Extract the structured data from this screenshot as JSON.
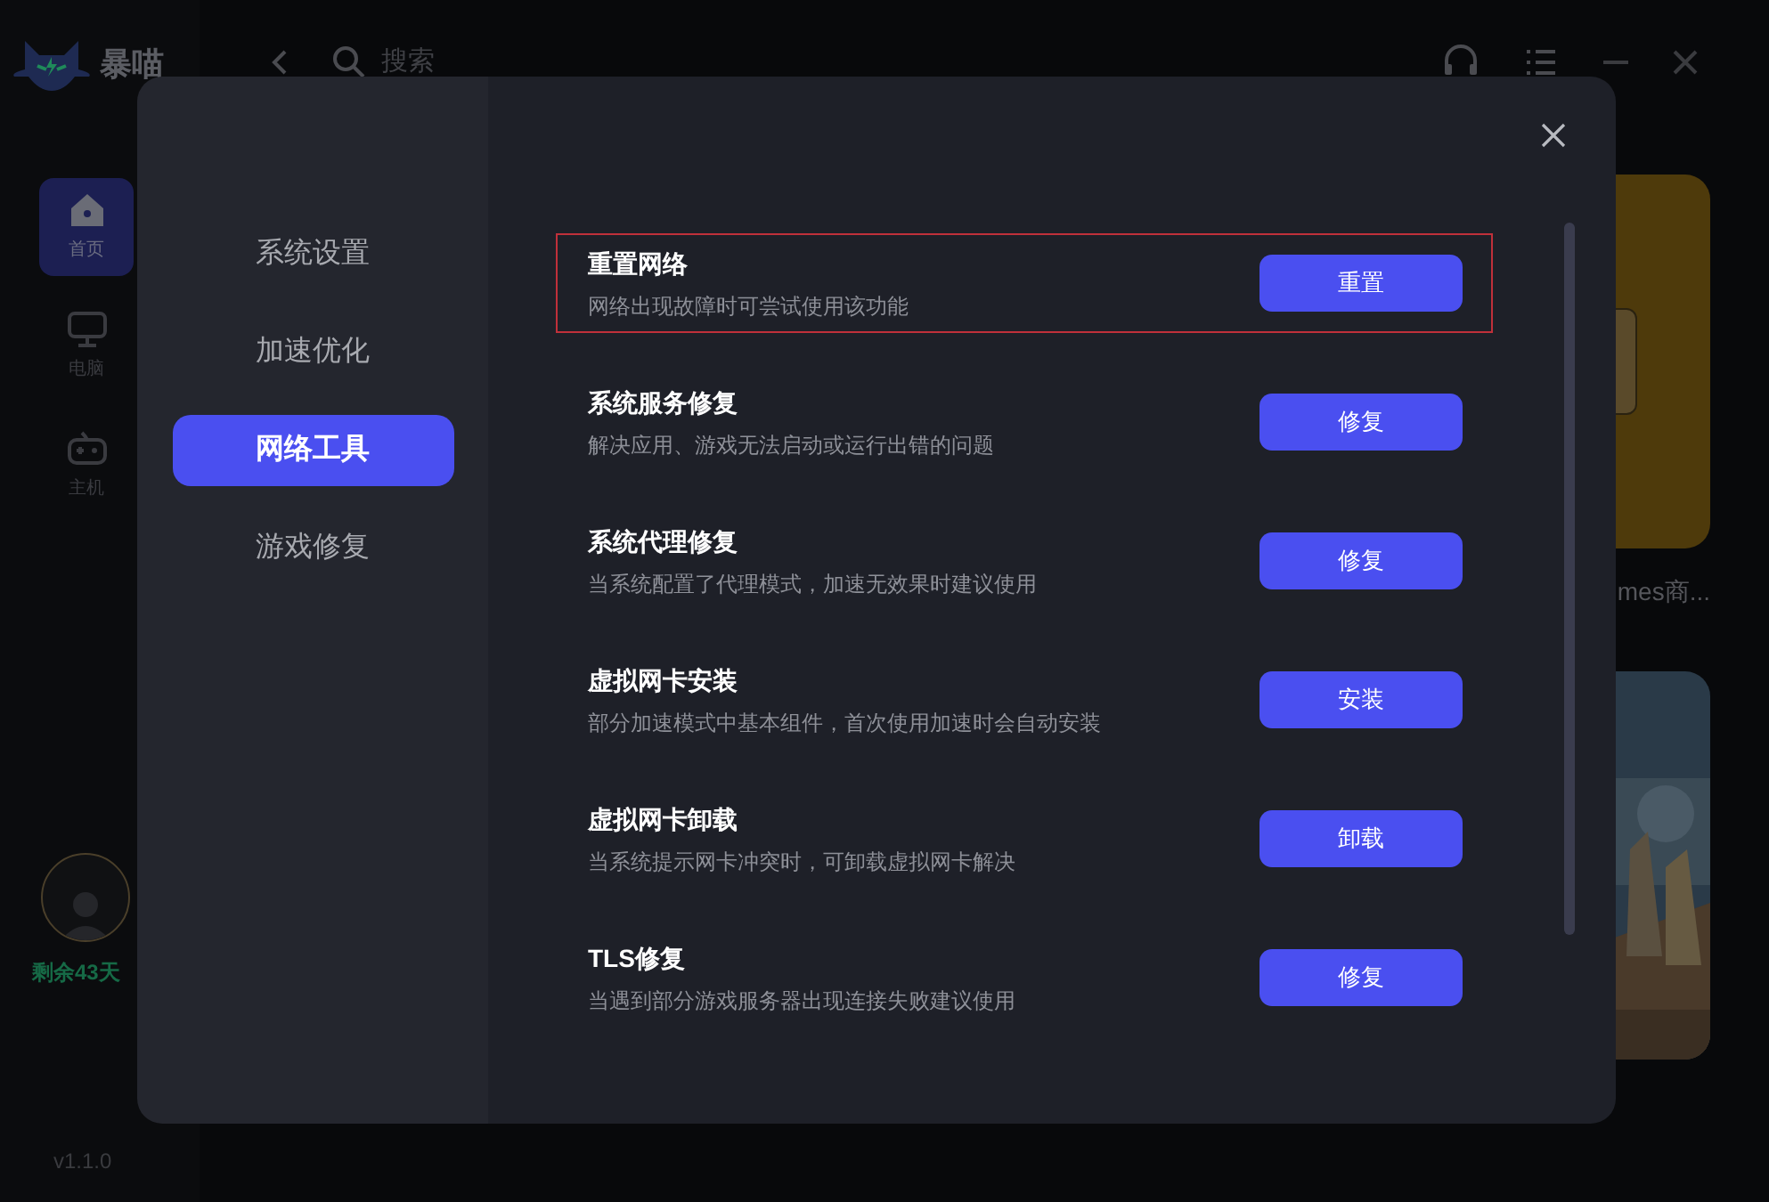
{
  "app": {
    "logo_text": "暴喵",
    "search": {
      "placeholder": "搜索"
    },
    "nav": [
      {
        "label": "首页",
        "selected": true
      },
      {
        "label": "电脑",
        "selected": false
      },
      {
        "label": "主机",
        "selected": false
      }
    ],
    "account": {
      "remaining": "剩余43天"
    },
    "version": "v1.1.0",
    "cards": [
      {
        "kind": "tile",
        "title": "mes商..."
      },
      {
        "kind": "picture"
      }
    ]
  },
  "dialog": {
    "menu": [
      {
        "label": "系统设置",
        "selected": false
      },
      {
        "label": "加速优化",
        "selected": false
      },
      {
        "label": "网络工具",
        "selected": true
      },
      {
        "label": "游戏修复",
        "selected": false
      }
    ],
    "tools": [
      {
        "title": "重置网络",
        "description": "网络出现故障时可尝试使用该功能",
        "button": "重置",
        "highlighted": true
      },
      {
        "title": "系统服务修复",
        "description": "解决应用、游戏无法启动或运行出错的问题",
        "button": "修复",
        "highlighted": false
      },
      {
        "title": "系统代理修复",
        "description": "当系统配置了代理模式，加速无效果时建议使用",
        "button": "修复",
        "highlighted": false
      },
      {
        "title": "虚拟网卡安装",
        "description": "部分加速模式中基本组件，首次使用加速时会自动安装",
        "button": "安装",
        "highlighted": false
      },
      {
        "title": "虚拟网卡卸载",
        "description": "当系统提示网卡冲突时，可卸载虚拟网卡解决",
        "button": "卸载",
        "highlighted": false
      },
      {
        "title": "TLS修复",
        "description": "当遇到部分游戏服务器出现连接失败建议使用",
        "button": "修复",
        "highlighted": false
      }
    ]
  }
}
